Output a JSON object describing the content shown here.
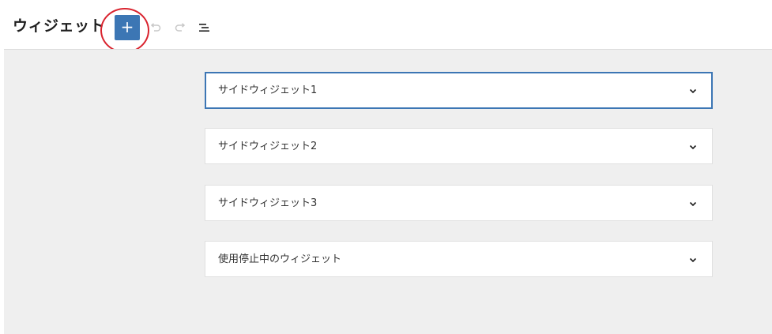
{
  "header": {
    "title": "ウィジェット",
    "add_button_label": "+",
    "icons": [
      "plus-icon",
      "undo-icon",
      "redo-icon",
      "list-view-icon"
    ]
  },
  "panels": [
    {
      "label": "サイドウィジェット1",
      "active": true
    },
    {
      "label": "サイドウィジェット2",
      "active": false
    },
    {
      "label": "サイドウィジェット3",
      "active": false
    },
    {
      "label": "使用停止中のウィジェット",
      "active": false
    }
  ],
  "colors": {
    "accent": "#3c76b4",
    "annotation_circle": "#d9232e",
    "canvas_bg": "#efefef"
  }
}
